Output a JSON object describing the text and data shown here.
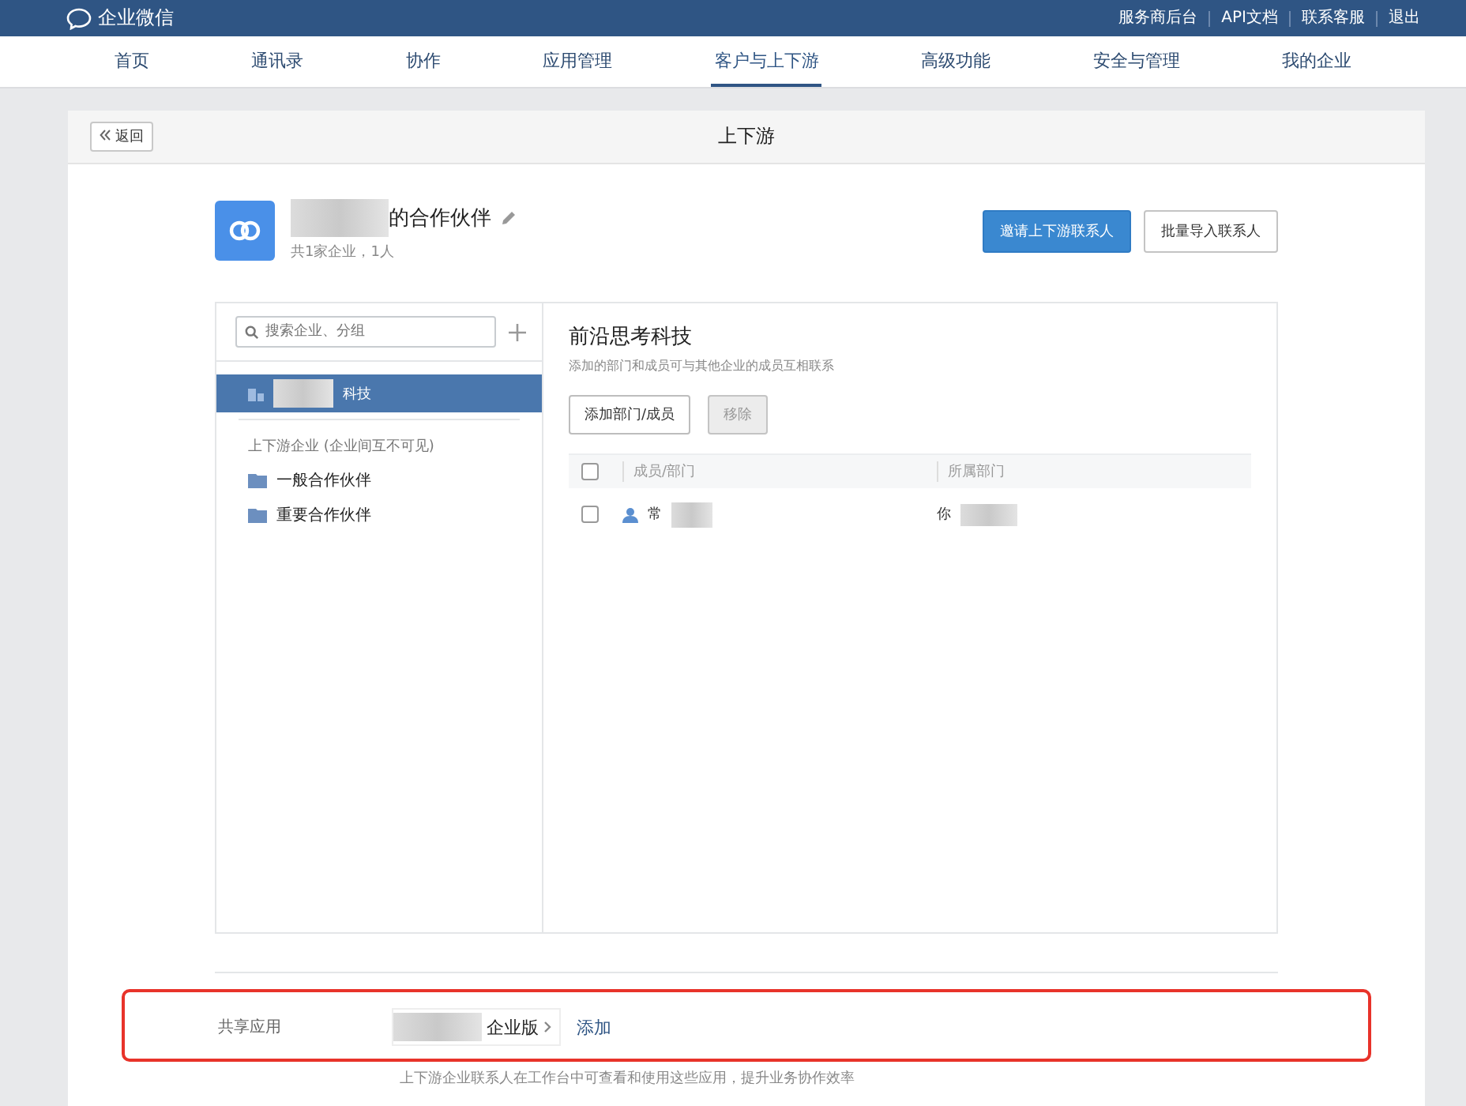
{
  "top_bar": {
    "logo_text": "企业微信",
    "links": [
      "服务商后台",
      "API文档",
      "联系客服",
      "退出"
    ]
  },
  "nav": {
    "tabs": [
      {
        "label": "首页",
        "selected": false
      },
      {
        "label": "通讯录",
        "selected": false
      },
      {
        "label": "协作",
        "selected": false
      },
      {
        "label": "应用管理",
        "selected": false
      },
      {
        "label": "客户与上下游",
        "selected": true
      },
      {
        "label": "高级功能",
        "selected": false
      },
      {
        "label": "安全与管理",
        "selected": false
      },
      {
        "label": "我的企业",
        "selected": false
      }
    ]
  },
  "page": {
    "back_button": "返回",
    "title": "上下游"
  },
  "partner": {
    "name_suffix": "的合作伙伴",
    "summary": "共1家企业，1人",
    "buttons": [
      {
        "label": "邀请上下游联系人",
        "kind": "primary"
      },
      {
        "label": "批量导入联系人",
        "kind": "default"
      }
    ]
  },
  "sidebar": {
    "search": {
      "placeholder": "搜索企业、分组"
    },
    "companies": [
      {
        "label": "科技",
        "selected": true
      }
    ],
    "group_heading": "上下游企业 (企业间互不可见)",
    "groups": [
      {
        "label": "一般合作伙伴"
      },
      {
        "label": "重要合作伙伴"
      }
    ]
  },
  "detail": {
    "title": "前沿思考科技",
    "description": "添加的部门和成员可与其他企业的成员互相联系",
    "buttons": [
      {
        "label": "添加部门/成员",
        "disabled": false
      },
      {
        "label": "移除",
        "disabled": true
      }
    ],
    "header_checked": false,
    "columns": [
      "成员/部门",
      "所属部门"
    ],
    "rows": [
      {
        "member": "常",
        "department": "你",
        "checked": false
      }
    ]
  },
  "shared_apps": {
    "label": "共享应用",
    "app": "企业版",
    "add_link": "添加",
    "note": "上下游企业联系人在工作台中可查看和使用这些应用，提升业务协作效率",
    "highlighted": true
  }
}
